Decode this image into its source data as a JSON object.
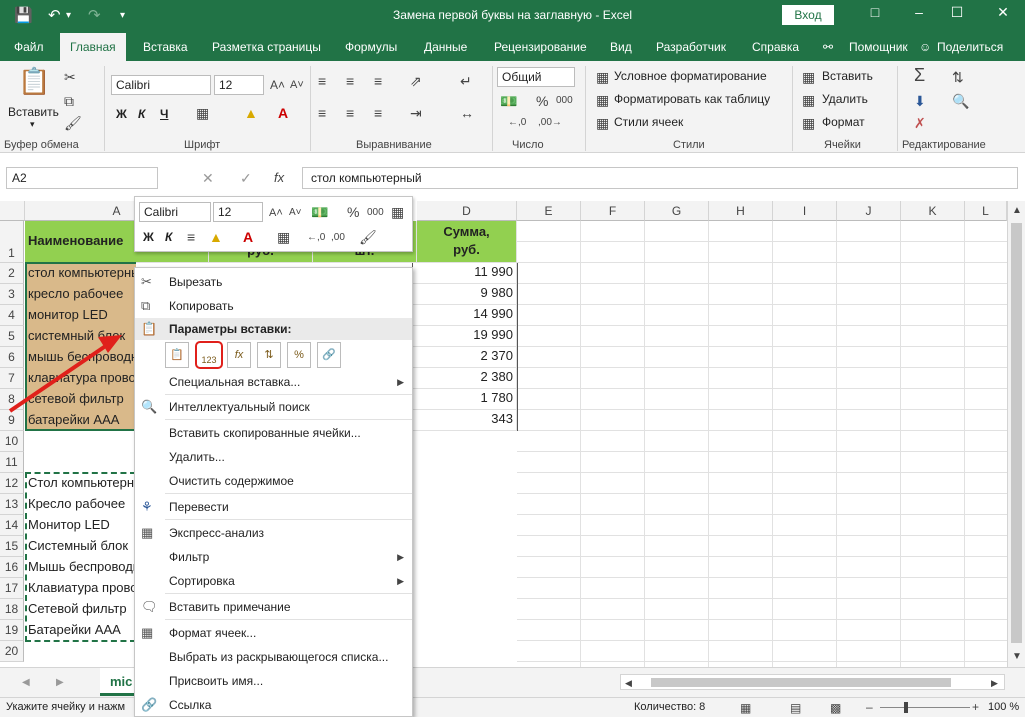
{
  "window": {
    "title": "Замена первой буквы на заглавную  -  Excel",
    "login_label": "Вход"
  },
  "ribbon_tabs": [
    "Файл",
    "Главная",
    "Вставка",
    "Разметка страницы",
    "Формулы",
    "Данные",
    "Рецензирование",
    "Вид",
    "Разработчик",
    "Справка",
    "Помощник",
    "Поделиться"
  ],
  "ribbon": {
    "paste_label": "Вставить",
    "font_name": "Calibri",
    "font_size": "12",
    "bold": "Ж",
    "italic": "К",
    "underline": "Ч",
    "number_format": "Общий",
    "cond_format": "Условное форматирование",
    "format_table": "Форматировать как таблицу",
    "cell_styles": "Стили ячеек",
    "insert_cells": "Вставить",
    "delete_cells": "Удалить",
    "format_cells": "Формат",
    "groups": [
      "Буфер обмена",
      "Шрифт",
      "Выравнивание",
      "Число",
      "Стили",
      "Ячейки",
      "Редактирование"
    ]
  },
  "formula_bar": {
    "name_box": "A2",
    "fx": "fx",
    "formula": "стол компьютерный"
  },
  "columns": [
    "A",
    "B",
    "C",
    "D",
    "E",
    "F",
    "G",
    "H",
    "I",
    "J",
    "K",
    "L"
  ],
  "rows": [
    "1",
    "2",
    "3",
    "4",
    "5",
    "6",
    "7",
    "8",
    "9",
    "10",
    "11",
    "12",
    "13",
    "14",
    "15",
    "16",
    "17",
    "18",
    "19",
    "20"
  ],
  "table": {
    "header_a": "Наименование",
    "header_b": "руб.",
    "header_c": "шт.",
    "header_d": "Сумма, руб.",
    "col_a": [
      "стол компьютерный",
      "кресло рабочее",
      "монитор LED",
      "системный блок",
      "мышь беспроводная",
      "клавиатура проводная",
      "сетевой фильтр",
      "батарейки ААА"
    ],
    "col_d": [
      "11 990",
      "9 980",
      "14 990",
      "19 990",
      "2 370",
      "2 380",
      "1 780",
      "343"
    ],
    "copy_a": [
      "Стол компьютерный",
      "Кресло рабочее",
      "Монитор LED",
      "Системный блок",
      "Мышь беспроводная",
      "Клавиатура проводная",
      "Сетевой фильтр",
      "Батарейки ААА"
    ]
  },
  "mini_toolbar": {
    "font_name": "Calibri",
    "font_size": "12",
    "bold": "Ж",
    "italic": "К",
    "percent": "%",
    "thousands": "000"
  },
  "context_menu": {
    "cut": "Вырезать",
    "copy": "Копировать",
    "paste_options": "Параметры вставки:",
    "paste_values_label": "123",
    "paste_special": "Специальная вставка...",
    "smart_lookup": "Интеллектуальный поиск",
    "insert_copied": "Вставить скопированные ячейки...",
    "delete": "Удалить...",
    "clear": "Очистить содержимое",
    "translate": "Перевести",
    "quick_analysis": "Экспресс-анализ",
    "filter": "Фильтр",
    "sort": "Сортировка",
    "insert_comment": "Вставить примечание",
    "format_cells": "Формат ячеек...",
    "pick_list": "Выбрать из раскрывающегося списка...",
    "define_name": "Присвоить имя...",
    "link": "Ссылка"
  },
  "sheet_tab": "mic",
  "status": {
    "message": "Укажите ячейку и нажм",
    "count": "Количество: 8",
    "zoom": "100 %"
  },
  "colors": {
    "brand": "#217346",
    "header_fill": "#92d050",
    "selection_fill": "#d9b98a",
    "highlight_red": "#e0201b"
  }
}
